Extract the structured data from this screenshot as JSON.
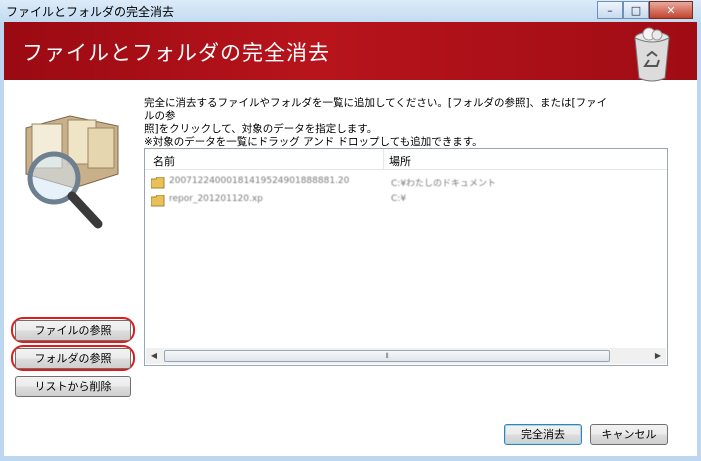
{
  "window": {
    "title": "ファイルとフォルダの完全消去",
    "controls": {
      "minimize": "–",
      "maximize": "□",
      "close": "✕"
    }
  },
  "banner": {
    "title": "ファイルとフォルダの完全消去"
  },
  "instructions": {
    "line1": "完全に消去するファイルやフォルダを一覧に追加してください。[フォルダの参照]、または[ファイルの参",
    "line2": "照]をクリックして、対象のデータを指定します。",
    "line3": "※対象のデータを一覧にドラッグ アンド ドロップしても追加できます。"
  },
  "list": {
    "columns": {
      "name": "名前",
      "location": "場所"
    },
    "rows": [
      {
        "name": "20071224000181419524901888881.20",
        "location": "C:¥わたしのドキュメント"
      },
      {
        "name": "repor_201201120.xp",
        "location": "C:¥"
      }
    ]
  },
  "buttons": {
    "browse_files": "ファイルの参照",
    "browse_folders": "フォルダの参照",
    "remove_from_list": "リストから削除",
    "erase": "完全消去",
    "cancel": "キャンセル"
  },
  "icons": {
    "left_art": "magnifier-files-icon",
    "banner": "trash-bin-icon",
    "row": "folder-icon"
  },
  "colors": {
    "banner": "#a50d15",
    "highlight": "#e01b1b"
  }
}
